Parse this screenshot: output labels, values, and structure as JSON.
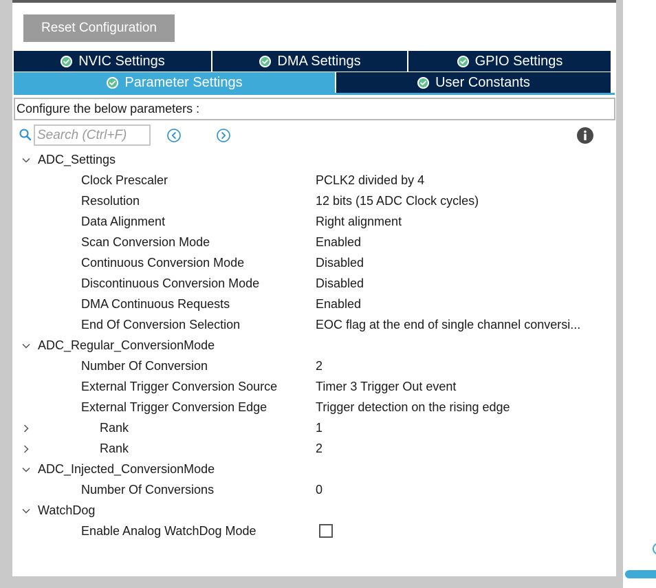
{
  "toolbar": {
    "reset_label": "Reset Configuration"
  },
  "tabs": {
    "row1": [
      {
        "label": "NVIC Settings"
      },
      {
        "label": "DMA Settings"
      },
      {
        "label": "GPIO Settings"
      }
    ],
    "row2": [
      {
        "label": "Parameter Settings",
        "active": true
      },
      {
        "label": "User Constants"
      }
    ]
  },
  "config_prompt": "Configure the below parameters :",
  "search": {
    "placeholder": "Search (Ctrl+F)"
  },
  "params": {
    "adc_settings": {
      "label": "ADC_Settings",
      "items": [
        {
          "label": "Clock Prescaler",
          "value": "PCLK2 divided by 4"
        },
        {
          "label": "Resolution",
          "value": "12 bits (15 ADC Clock cycles)"
        },
        {
          "label": "Data Alignment",
          "value": "Right alignment"
        },
        {
          "label": "Scan Conversion Mode",
          "value": "Enabled"
        },
        {
          "label": "Continuous Conversion Mode",
          "value": "Disabled"
        },
        {
          "label": "Discontinuous Conversion Mode",
          "value": "Disabled"
        },
        {
          "label": "DMA Continuous Requests",
          "value": "Enabled"
        },
        {
          "label": "End Of Conversion Selection",
          "value": "EOC flag at the end of single channel conversi..."
        }
      ]
    },
    "adc_regular": {
      "label": "ADC_Regular_ConversionMode",
      "items": [
        {
          "label": "Number Of Conversion",
          "value": "2"
        },
        {
          "label": "External Trigger Conversion Source",
          "value": "Timer 3 Trigger Out event"
        },
        {
          "label": "External Trigger Conversion Edge",
          "value": "Trigger detection on the rising edge"
        }
      ],
      "ranks": [
        {
          "label": "Rank",
          "value": "1"
        },
        {
          "label": "Rank",
          "value": "2"
        }
      ]
    },
    "adc_injected": {
      "label": "ADC_Injected_ConversionMode",
      "items": [
        {
          "label": "Number Of Conversions",
          "value": "0"
        }
      ]
    },
    "watchdog": {
      "label": "WatchDog",
      "items": [
        {
          "label": "Enable Analog WatchDog Mode",
          "checked": false
        }
      ]
    }
  },
  "colors": {
    "tab_dark": "#03234b",
    "tab_active": "#3eaad8",
    "button_gray": "#9b9b9b",
    "check_green": "#5fbf8f"
  },
  "icons": [
    "check-circle-icon",
    "search-icon",
    "prev-match-icon",
    "next-match-icon",
    "info-icon",
    "chevron-down-icon",
    "chevron-right-icon"
  ]
}
